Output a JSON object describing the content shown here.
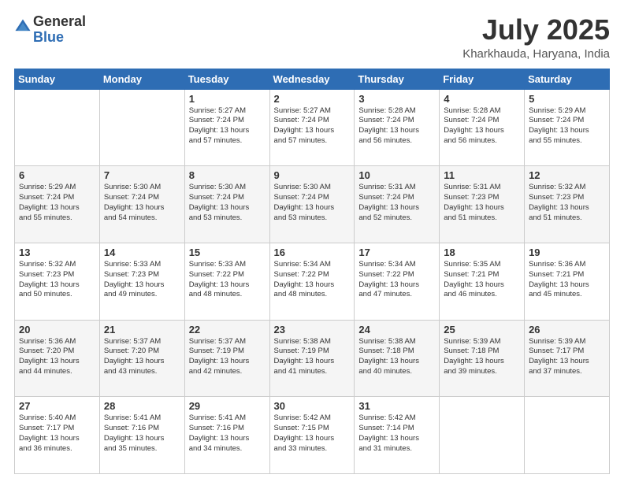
{
  "logo": {
    "line1": "General",
    "line2": "Blue"
  },
  "title": "July 2025",
  "location": "Kharkhauda, Haryana, India",
  "weekdays": [
    "Sunday",
    "Monday",
    "Tuesday",
    "Wednesday",
    "Thursday",
    "Friday",
    "Saturday"
  ],
  "weeks": [
    [
      {
        "day": "",
        "detail": ""
      },
      {
        "day": "",
        "detail": ""
      },
      {
        "day": "1",
        "detail": "Sunrise: 5:27 AM\nSunset: 7:24 PM\nDaylight: 13 hours\nand 57 minutes."
      },
      {
        "day": "2",
        "detail": "Sunrise: 5:27 AM\nSunset: 7:24 PM\nDaylight: 13 hours\nand 57 minutes."
      },
      {
        "day": "3",
        "detail": "Sunrise: 5:28 AM\nSunset: 7:24 PM\nDaylight: 13 hours\nand 56 minutes."
      },
      {
        "day": "4",
        "detail": "Sunrise: 5:28 AM\nSunset: 7:24 PM\nDaylight: 13 hours\nand 56 minutes."
      },
      {
        "day": "5",
        "detail": "Sunrise: 5:29 AM\nSunset: 7:24 PM\nDaylight: 13 hours\nand 55 minutes."
      }
    ],
    [
      {
        "day": "6",
        "detail": "Sunrise: 5:29 AM\nSunset: 7:24 PM\nDaylight: 13 hours\nand 55 minutes."
      },
      {
        "day": "7",
        "detail": "Sunrise: 5:30 AM\nSunset: 7:24 PM\nDaylight: 13 hours\nand 54 minutes."
      },
      {
        "day": "8",
        "detail": "Sunrise: 5:30 AM\nSunset: 7:24 PM\nDaylight: 13 hours\nand 53 minutes."
      },
      {
        "day": "9",
        "detail": "Sunrise: 5:30 AM\nSunset: 7:24 PM\nDaylight: 13 hours\nand 53 minutes."
      },
      {
        "day": "10",
        "detail": "Sunrise: 5:31 AM\nSunset: 7:24 PM\nDaylight: 13 hours\nand 52 minutes."
      },
      {
        "day": "11",
        "detail": "Sunrise: 5:31 AM\nSunset: 7:23 PM\nDaylight: 13 hours\nand 51 minutes."
      },
      {
        "day": "12",
        "detail": "Sunrise: 5:32 AM\nSunset: 7:23 PM\nDaylight: 13 hours\nand 51 minutes."
      }
    ],
    [
      {
        "day": "13",
        "detail": "Sunrise: 5:32 AM\nSunset: 7:23 PM\nDaylight: 13 hours\nand 50 minutes."
      },
      {
        "day": "14",
        "detail": "Sunrise: 5:33 AM\nSunset: 7:23 PM\nDaylight: 13 hours\nand 49 minutes."
      },
      {
        "day": "15",
        "detail": "Sunrise: 5:33 AM\nSunset: 7:22 PM\nDaylight: 13 hours\nand 48 minutes."
      },
      {
        "day": "16",
        "detail": "Sunrise: 5:34 AM\nSunset: 7:22 PM\nDaylight: 13 hours\nand 48 minutes."
      },
      {
        "day": "17",
        "detail": "Sunrise: 5:34 AM\nSunset: 7:22 PM\nDaylight: 13 hours\nand 47 minutes."
      },
      {
        "day": "18",
        "detail": "Sunrise: 5:35 AM\nSunset: 7:21 PM\nDaylight: 13 hours\nand 46 minutes."
      },
      {
        "day": "19",
        "detail": "Sunrise: 5:36 AM\nSunset: 7:21 PM\nDaylight: 13 hours\nand 45 minutes."
      }
    ],
    [
      {
        "day": "20",
        "detail": "Sunrise: 5:36 AM\nSunset: 7:20 PM\nDaylight: 13 hours\nand 44 minutes."
      },
      {
        "day": "21",
        "detail": "Sunrise: 5:37 AM\nSunset: 7:20 PM\nDaylight: 13 hours\nand 43 minutes."
      },
      {
        "day": "22",
        "detail": "Sunrise: 5:37 AM\nSunset: 7:19 PM\nDaylight: 13 hours\nand 42 minutes."
      },
      {
        "day": "23",
        "detail": "Sunrise: 5:38 AM\nSunset: 7:19 PM\nDaylight: 13 hours\nand 41 minutes."
      },
      {
        "day": "24",
        "detail": "Sunrise: 5:38 AM\nSunset: 7:18 PM\nDaylight: 13 hours\nand 40 minutes."
      },
      {
        "day": "25",
        "detail": "Sunrise: 5:39 AM\nSunset: 7:18 PM\nDaylight: 13 hours\nand 39 minutes."
      },
      {
        "day": "26",
        "detail": "Sunrise: 5:39 AM\nSunset: 7:17 PM\nDaylight: 13 hours\nand 37 minutes."
      }
    ],
    [
      {
        "day": "27",
        "detail": "Sunrise: 5:40 AM\nSunset: 7:17 PM\nDaylight: 13 hours\nand 36 minutes."
      },
      {
        "day": "28",
        "detail": "Sunrise: 5:41 AM\nSunset: 7:16 PM\nDaylight: 13 hours\nand 35 minutes."
      },
      {
        "day": "29",
        "detail": "Sunrise: 5:41 AM\nSunset: 7:16 PM\nDaylight: 13 hours\nand 34 minutes."
      },
      {
        "day": "30",
        "detail": "Sunrise: 5:42 AM\nSunset: 7:15 PM\nDaylight: 13 hours\nand 33 minutes."
      },
      {
        "day": "31",
        "detail": "Sunrise: 5:42 AM\nSunset: 7:14 PM\nDaylight: 13 hours\nand 31 minutes."
      },
      {
        "day": "",
        "detail": ""
      },
      {
        "day": "",
        "detail": ""
      }
    ]
  ]
}
